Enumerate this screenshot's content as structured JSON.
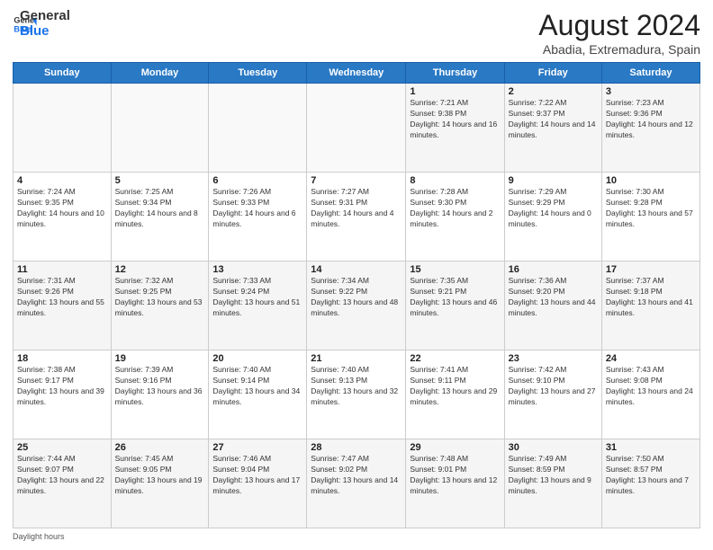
{
  "header": {
    "logo_general": "General",
    "logo_blue": "Blue",
    "month_year": "August 2024",
    "location": "Abadia, Extremadura, Spain"
  },
  "days_of_week": [
    "Sunday",
    "Monday",
    "Tuesday",
    "Wednesday",
    "Thursday",
    "Friday",
    "Saturday"
  ],
  "weeks": [
    [
      {
        "day": "",
        "sunrise": "",
        "sunset": "",
        "daylight": ""
      },
      {
        "day": "",
        "sunrise": "",
        "sunset": "",
        "daylight": ""
      },
      {
        "day": "",
        "sunrise": "",
        "sunset": "",
        "daylight": ""
      },
      {
        "day": "",
        "sunrise": "",
        "sunset": "",
        "daylight": ""
      },
      {
        "day": "1",
        "sunrise": "Sunrise: 7:21 AM",
        "sunset": "Sunset: 9:38 PM",
        "daylight": "Daylight: 14 hours and 16 minutes."
      },
      {
        "day": "2",
        "sunrise": "Sunrise: 7:22 AM",
        "sunset": "Sunset: 9:37 PM",
        "daylight": "Daylight: 14 hours and 14 minutes."
      },
      {
        "day": "3",
        "sunrise": "Sunrise: 7:23 AM",
        "sunset": "Sunset: 9:36 PM",
        "daylight": "Daylight: 14 hours and 12 minutes."
      }
    ],
    [
      {
        "day": "4",
        "sunrise": "Sunrise: 7:24 AM",
        "sunset": "Sunset: 9:35 PM",
        "daylight": "Daylight: 14 hours and 10 minutes."
      },
      {
        "day": "5",
        "sunrise": "Sunrise: 7:25 AM",
        "sunset": "Sunset: 9:34 PM",
        "daylight": "Daylight: 14 hours and 8 minutes."
      },
      {
        "day": "6",
        "sunrise": "Sunrise: 7:26 AM",
        "sunset": "Sunset: 9:33 PM",
        "daylight": "Daylight: 14 hours and 6 minutes."
      },
      {
        "day": "7",
        "sunrise": "Sunrise: 7:27 AM",
        "sunset": "Sunset: 9:31 PM",
        "daylight": "Daylight: 14 hours and 4 minutes."
      },
      {
        "day": "8",
        "sunrise": "Sunrise: 7:28 AM",
        "sunset": "Sunset: 9:30 PM",
        "daylight": "Daylight: 14 hours and 2 minutes."
      },
      {
        "day": "9",
        "sunrise": "Sunrise: 7:29 AM",
        "sunset": "Sunset: 9:29 PM",
        "daylight": "Daylight: 14 hours and 0 minutes."
      },
      {
        "day": "10",
        "sunrise": "Sunrise: 7:30 AM",
        "sunset": "Sunset: 9:28 PM",
        "daylight": "Daylight: 13 hours and 57 minutes."
      }
    ],
    [
      {
        "day": "11",
        "sunrise": "Sunrise: 7:31 AM",
        "sunset": "Sunset: 9:26 PM",
        "daylight": "Daylight: 13 hours and 55 minutes."
      },
      {
        "day": "12",
        "sunrise": "Sunrise: 7:32 AM",
        "sunset": "Sunset: 9:25 PM",
        "daylight": "Daylight: 13 hours and 53 minutes."
      },
      {
        "day": "13",
        "sunrise": "Sunrise: 7:33 AM",
        "sunset": "Sunset: 9:24 PM",
        "daylight": "Daylight: 13 hours and 51 minutes."
      },
      {
        "day": "14",
        "sunrise": "Sunrise: 7:34 AM",
        "sunset": "Sunset: 9:22 PM",
        "daylight": "Daylight: 13 hours and 48 minutes."
      },
      {
        "day": "15",
        "sunrise": "Sunrise: 7:35 AM",
        "sunset": "Sunset: 9:21 PM",
        "daylight": "Daylight: 13 hours and 46 minutes."
      },
      {
        "day": "16",
        "sunrise": "Sunrise: 7:36 AM",
        "sunset": "Sunset: 9:20 PM",
        "daylight": "Daylight: 13 hours and 44 minutes."
      },
      {
        "day": "17",
        "sunrise": "Sunrise: 7:37 AM",
        "sunset": "Sunset: 9:18 PM",
        "daylight": "Daylight: 13 hours and 41 minutes."
      }
    ],
    [
      {
        "day": "18",
        "sunrise": "Sunrise: 7:38 AM",
        "sunset": "Sunset: 9:17 PM",
        "daylight": "Daylight: 13 hours and 39 minutes."
      },
      {
        "day": "19",
        "sunrise": "Sunrise: 7:39 AM",
        "sunset": "Sunset: 9:16 PM",
        "daylight": "Daylight: 13 hours and 36 minutes."
      },
      {
        "day": "20",
        "sunrise": "Sunrise: 7:40 AM",
        "sunset": "Sunset: 9:14 PM",
        "daylight": "Daylight: 13 hours and 34 minutes."
      },
      {
        "day": "21",
        "sunrise": "Sunrise: 7:40 AM",
        "sunset": "Sunset: 9:13 PM",
        "daylight": "Daylight: 13 hours and 32 minutes."
      },
      {
        "day": "22",
        "sunrise": "Sunrise: 7:41 AM",
        "sunset": "Sunset: 9:11 PM",
        "daylight": "Daylight: 13 hours and 29 minutes."
      },
      {
        "day": "23",
        "sunrise": "Sunrise: 7:42 AM",
        "sunset": "Sunset: 9:10 PM",
        "daylight": "Daylight: 13 hours and 27 minutes."
      },
      {
        "day": "24",
        "sunrise": "Sunrise: 7:43 AM",
        "sunset": "Sunset: 9:08 PM",
        "daylight": "Daylight: 13 hours and 24 minutes."
      }
    ],
    [
      {
        "day": "25",
        "sunrise": "Sunrise: 7:44 AM",
        "sunset": "Sunset: 9:07 PM",
        "daylight": "Daylight: 13 hours and 22 minutes."
      },
      {
        "day": "26",
        "sunrise": "Sunrise: 7:45 AM",
        "sunset": "Sunset: 9:05 PM",
        "daylight": "Daylight: 13 hours and 19 minutes."
      },
      {
        "day": "27",
        "sunrise": "Sunrise: 7:46 AM",
        "sunset": "Sunset: 9:04 PM",
        "daylight": "Daylight: 13 hours and 17 minutes."
      },
      {
        "day": "28",
        "sunrise": "Sunrise: 7:47 AM",
        "sunset": "Sunset: 9:02 PM",
        "daylight": "Daylight: 13 hours and 14 minutes."
      },
      {
        "day": "29",
        "sunrise": "Sunrise: 7:48 AM",
        "sunset": "Sunset: 9:01 PM",
        "daylight": "Daylight: 13 hours and 12 minutes."
      },
      {
        "day": "30",
        "sunrise": "Sunrise: 7:49 AM",
        "sunset": "Sunset: 8:59 PM",
        "daylight": "Daylight: 13 hours and 9 minutes."
      },
      {
        "day": "31",
        "sunrise": "Sunrise: 7:50 AM",
        "sunset": "Sunset: 8:57 PM",
        "daylight": "Daylight: 13 hours and 7 minutes."
      }
    ]
  ],
  "footer": {
    "daylight_label": "Daylight hours"
  }
}
